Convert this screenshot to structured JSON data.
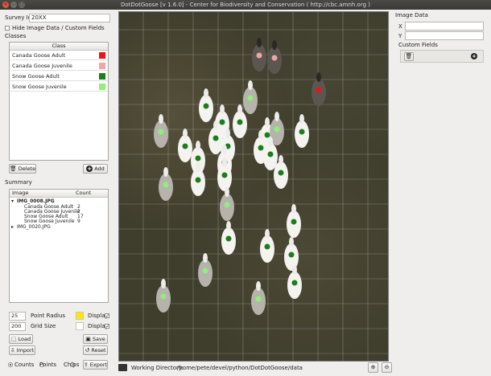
{
  "window": {
    "title": "DotDotGoose [v 1.6.0] - Center for Biodiversity and Conservation ( http://cbc.amnh.org )"
  },
  "survey": {
    "label": "Survey Id",
    "value": "20XX"
  },
  "hide_image_data": {
    "label": "Hide Image Data / Custom Fields"
  },
  "classes": {
    "label": "Classes",
    "header": "Class",
    "items": [
      {
        "name": "Canada Goose Adult",
        "color": "#e8161a"
      },
      {
        "name": "Canada Goose Juvenile",
        "color": "#f0a6a6"
      },
      {
        "name": "Snow Goose Adult",
        "color": "#1a7e1a"
      },
      {
        "name": "Snow Goose Juvenile",
        "color": "#8ef07a"
      }
    ],
    "delete_label": "Delete",
    "add_label": "Add"
  },
  "summary": {
    "label": "Summary",
    "col_image": "Image",
    "col_count": "Count",
    "images": [
      {
        "name": "IMG_0008.JPG",
        "expanded": true,
        "rows": [
          {
            "class": "Canada Goose Adult",
            "count": "2"
          },
          {
            "class": "Canada Goose Juvenile",
            "count": "2"
          },
          {
            "class": "Snow Goose Adult",
            "count": "17"
          },
          {
            "class": "Snow Goose Juvenile",
            "count": "9"
          }
        ]
      },
      {
        "name": "IMG_0020.JPG",
        "expanded": false,
        "rows": []
      }
    ]
  },
  "point_radius": {
    "value": "25",
    "label": "Point Radius",
    "color": "#ffe800",
    "display_label": "Display",
    "display_checked": true
  },
  "grid_size": {
    "value": "200",
    "label": "Grid Size",
    "color": "#ffffff",
    "display_label": "Display",
    "display_checked": true
  },
  "buttons": {
    "load": "Load",
    "save": "Save",
    "import": "Import",
    "reset": "Reset",
    "export": "Export"
  },
  "export_modes": {
    "counts": "Counts",
    "points": "Points",
    "chips": "Chips",
    "selected": "Counts"
  },
  "status": {
    "working_label": "Working Directory:",
    "working_path": "/home/pete/devel/python/DotDotGoose/data"
  },
  "image_data": {
    "label": "Image Data",
    "x_label": "X",
    "y_label": "Y",
    "custom_fields_label": "Custom Fields"
  },
  "icons": {
    "zoom_in": "zoom-in-icon",
    "zoom_out": "zoom-out-icon",
    "folder": "folder-icon",
    "trash": "trash-icon",
    "add": "plus-icon"
  }
}
